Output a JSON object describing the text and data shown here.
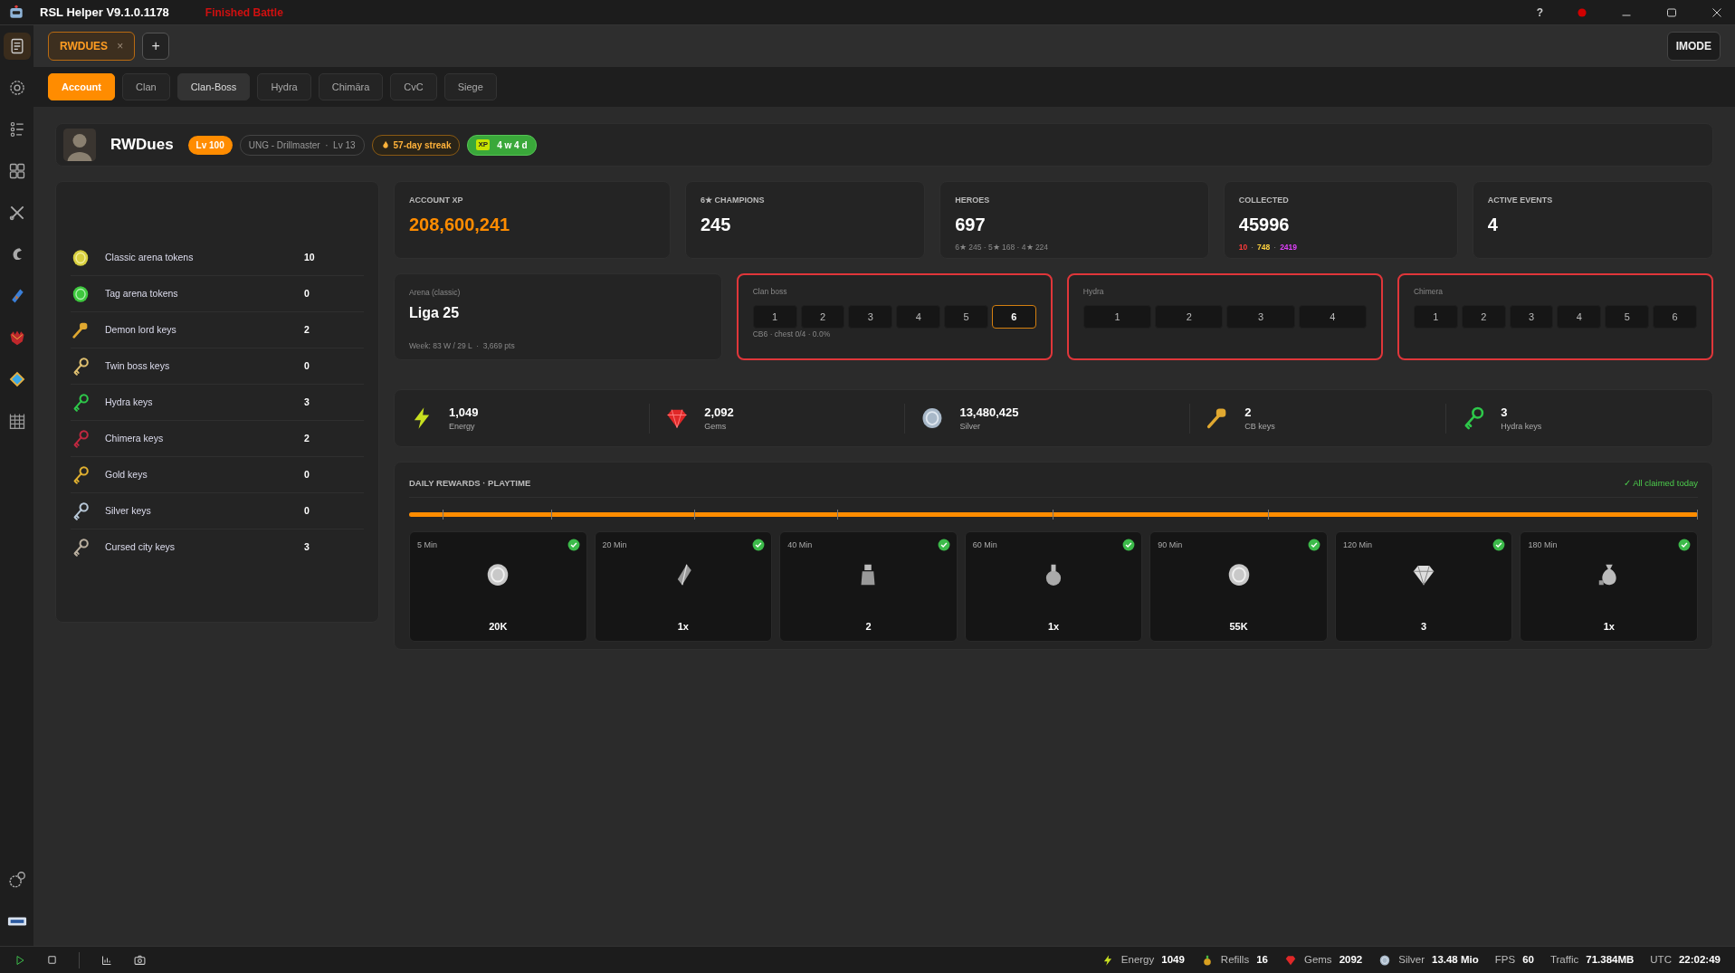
{
  "title_bar": {
    "app_title": "RSL Helper V9.1.0.1178",
    "status": "Finished Battle",
    "help": "?"
  },
  "sidebar": {
    "items": [
      {
        "selected": true
      },
      {
        "selected": false
      },
      {
        "selected": false
      },
      {
        "selected": false
      },
      {
        "selected": false
      },
      {
        "selected": false
      },
      {
        "selected": false
      },
      {
        "selected": false
      },
      {
        "selected": false
      },
      {
        "selected": false
      }
    ]
  },
  "session_tabs": [
    {
      "label": "RWDUES",
      "close": "×",
      "selected": true
    }
  ],
  "add_tab": "+",
  "mode_button": "IMODE",
  "sub_tabs": [
    {
      "label": "Account",
      "selected": true,
      "hovered": false
    },
    {
      "label": "Clan",
      "selected": false,
      "hovered": false
    },
    {
      "label": "Clan-Boss",
      "selected": false,
      "hovered": true
    },
    {
      "label": "Hydra",
      "selected": false,
      "hovered": false
    },
    {
      "label": "Chimära",
      "selected": false,
      "hovered": false
    },
    {
      "label": "CvC",
      "selected": false,
      "hovered": false
    },
    {
      "label": "Siege",
      "selected": false,
      "hovered": false
    }
  ],
  "profile": {
    "name": "RWDues",
    "level": "Lv 100",
    "clan": "UNG - Drillmaster",
    "clan_separator": "·",
    "clan_level": "Lv 13",
    "streak": "57-day streak",
    "xp_tag": "XP",
    "xp_time": "4 w 4 d"
  },
  "inventory": [
    {
      "name": "Classic arena tokens",
      "count": "10"
    },
    {
      "name": "Tag arena tokens",
      "count": "0"
    },
    {
      "name": "Demon lord keys",
      "count": "2"
    },
    {
      "name": "Twin boss keys",
      "count": "0"
    },
    {
      "name": "Hydra keys",
      "count": "3"
    },
    {
      "name": "Chimera keys",
      "count": "2"
    },
    {
      "name": "Gold keys",
      "count": "0"
    },
    {
      "name": "Silver keys",
      "count": "0"
    },
    {
      "name": "Cursed city keys",
      "count": "3"
    }
  ],
  "stats": [
    {
      "label": "ACCOUNT XP",
      "value": "208,600,241",
      "accent": true
    },
    {
      "label": "6★ CHAMPIONS",
      "value": "245",
      "accent": false
    },
    {
      "label": "HEROES",
      "value": "697",
      "accent": false,
      "note": "6★ 245 · 5★ 168 · 4★ 224"
    },
    {
      "label": "COLLECTED",
      "value": "45996",
      "accent": false,
      "separator": "·",
      "parts": [
        {
          "text": "10",
          "color": "#ff3b3b"
        },
        {
          "text": "748",
          "color": "#ffd23f"
        },
        {
          "text": "2419",
          "color": "#e040fb"
        }
      ]
    },
    {
      "label": "ACTIVE EVENTS",
      "value": "4",
      "accent": false
    }
  ],
  "arena": {
    "label": "Arena (classic)",
    "value": "Liga 25",
    "note": "Week: 83 W / 29 L  ·  3,669 pts"
  },
  "boss_panels": [
    {
      "title": "Clan boss",
      "alert": true,
      "note": "CB6 · chest 0/4 · 0.0%",
      "levels": [
        {
          "label": "1",
          "selected": false
        },
        {
          "label": "2",
          "selected": false
        },
        {
          "label": "3",
          "selected": false
        },
        {
          "label": "4",
          "selected": false
        },
        {
          "label": "5",
          "selected": false
        },
        {
          "label": "6",
          "selected": true
        }
      ]
    },
    {
      "title": "Hydra",
      "alert": true,
      "levels": [
        {
          "label": "1",
          "selected": false
        },
        {
          "label": "2",
          "selected": false
        },
        {
          "label": "3",
          "selected": false
        },
        {
          "label": "4",
          "selected": false
        }
      ]
    },
    {
      "title": "Chimera",
      "alert": true,
      "levels": [
        {
          "label": "1",
          "selected": false
        },
        {
          "label": "2",
          "selected": false
        },
        {
          "label": "3",
          "selected": false
        },
        {
          "label": "4",
          "selected": false
        },
        {
          "label": "5",
          "selected": false
        },
        {
          "label": "6",
          "selected": false
        }
      ]
    }
  ],
  "resources": [
    {
      "value": "1,049",
      "label": "Energy"
    },
    {
      "value": "2,092",
      "label": "Gems"
    },
    {
      "value": "13,480,425",
      "label": "Silver"
    },
    {
      "value": "2",
      "label": "CB keys"
    },
    {
      "value": "3",
      "label": "Hydra keys"
    }
  ],
  "daily_rewards": {
    "title": "DAILY REWARDS · PLAYTIME",
    "status": "✓ All claimed today",
    "level": 1,
    "rewards": [
      {
        "time": "5 Min",
        "amount": "20K",
        "claimed": true
      },
      {
        "time": "20 Min",
        "amount": "1x",
        "claimed": true
      },
      {
        "time": "40 Min",
        "amount": "2",
        "claimed": true
      },
      {
        "time": "60 Min",
        "amount": "1x",
        "claimed": true
      },
      {
        "time": "90 Min",
        "amount": "55K",
        "claimed": true
      },
      {
        "time": "120 Min",
        "amount": "3",
        "claimed": true
      },
      {
        "time": "180 Min",
        "amount": "1x",
        "claimed": true
      }
    ]
  },
  "status_bar": {
    "stats": [
      {
        "label": "Energy",
        "value": "1049"
      },
      {
        "label": "Refills",
        "value": "16"
      },
      {
        "label": "Gems",
        "value": "2092"
      },
      {
        "label": "Silver",
        "value": "13.48 Mio"
      },
      {
        "label": "FPS",
        "value": "60"
      },
      {
        "label": "Traffic",
        "value": "71.384MB"
      },
      {
        "label": "UTC",
        "value": "22:02:49"
      }
    ]
  }
}
